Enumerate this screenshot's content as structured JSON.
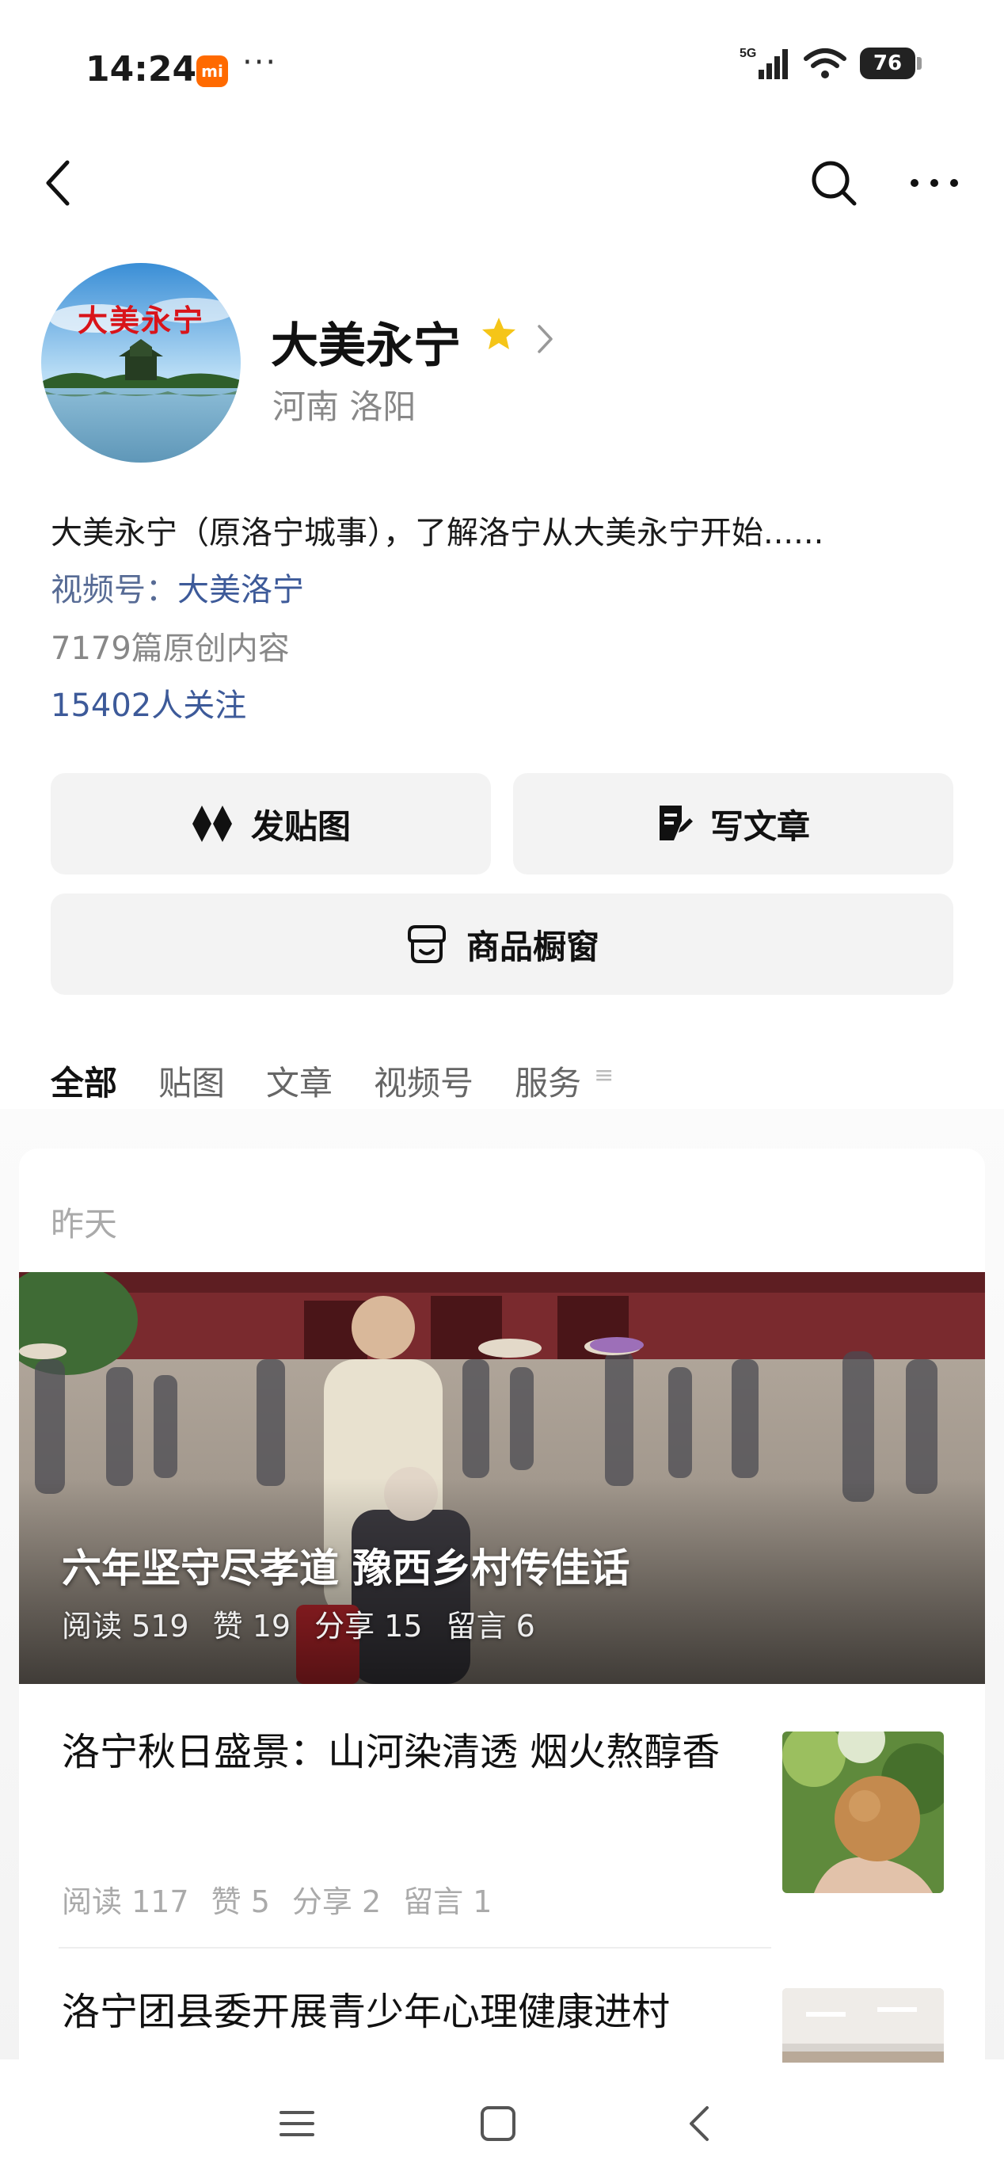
{
  "status_bar": {
    "time": "14:24",
    "mi_badge": "mi",
    "dots": "···",
    "network": "5G",
    "battery": "76"
  },
  "profile": {
    "avatar_text": "大美永宁",
    "name": "大美永宁",
    "location": "河南 洛阳",
    "description": "大美永宁（原洛宁城事），了解洛宁从大美永宁开始......",
    "video_channel_label": "视频号：",
    "video_channel_name": "大美洛宁",
    "original_count": "7179篇原创内容",
    "followers": "15402人关注"
  },
  "actions": {
    "post_image": "发贴图",
    "write_article": "写文章",
    "shop_window": "商品橱窗"
  },
  "tabs": [
    {
      "label": "全部",
      "active": true
    },
    {
      "label": "贴图",
      "active": false
    },
    {
      "label": "文章",
      "active": false
    },
    {
      "label": "视频号",
      "active": false
    },
    {
      "label": "服务",
      "active": false
    }
  ],
  "feed": {
    "date_label": "昨天",
    "hero": {
      "title": "六年坚守尽孝道 豫西乡村传佳话",
      "reads": "阅读 519",
      "likes": "赞 19",
      "shares": "分享 15",
      "comments": "留言 6"
    },
    "articles": [
      {
        "title": "洛宁秋日盛景：山河染清透 烟火熬醇香",
        "reads": "阅读 117",
        "likes": "赞 5",
        "shares": "分享 2",
        "comments": "留言 1"
      },
      {
        "title": "洛宁团县委开展青少年心理健康进村"
      }
    ]
  },
  "colors": {
    "link_blue": "#3d5a99",
    "star_yellow": "#f5c518",
    "button_bg": "#f3f3f3",
    "brand_orange": "#ff6a00"
  }
}
